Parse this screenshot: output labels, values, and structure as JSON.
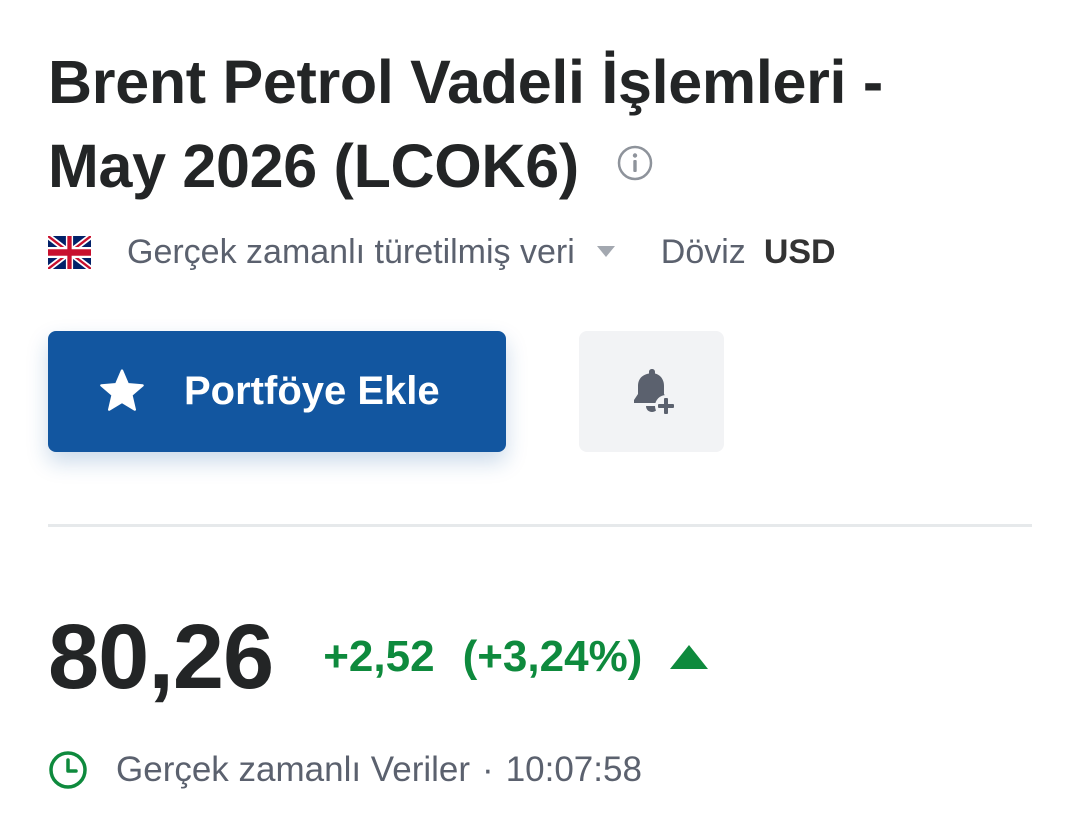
{
  "instrument": {
    "title_line1": "Brent Petrol Vadeli İşlemleri -",
    "title_line2": "May 2026 (LCOK6)",
    "info_icon": "info-icon"
  },
  "meta": {
    "flag_icon": "uk-flag-icon",
    "data_source": "Gerçek zamanlı türetilmiş veri",
    "currency_label": "Döviz",
    "currency_value": "USD"
  },
  "actions": {
    "portfolio_label": "Portföye Ekle",
    "portfolio_icon": "star-icon",
    "alert_icon": "bell-plus-icon"
  },
  "quote": {
    "price": "80,26",
    "change": "+2,52",
    "change_pct": "(+3,24%)",
    "direction": "up",
    "up_color": "#0e8a3d"
  },
  "status": {
    "label": "Gerçek zamanlı Veriler",
    "separator": "·",
    "time": "10:07:58"
  },
  "colors": {
    "brand_blue": "#1256a0",
    "text_primary": "#232526",
    "text_secondary": "#5b616e"
  }
}
